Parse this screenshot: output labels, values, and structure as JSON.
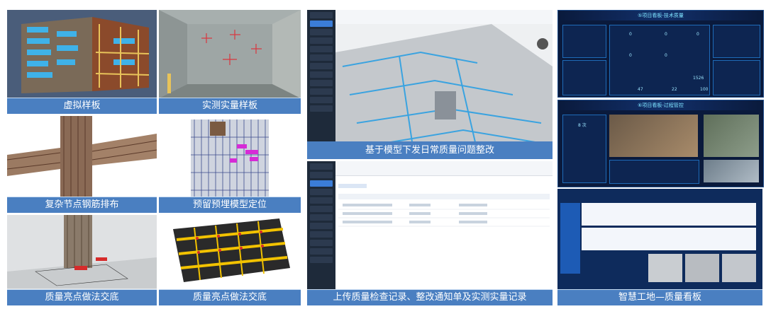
{
  "captions": {
    "virtual_sample": "虚拟样板",
    "measured_sample": "实测实量样板",
    "rebar_layout": "复杂节点钢筋排布",
    "embedded_position": "预留预埋模型定位",
    "quality_demo_1": "质量亮点做法交底",
    "quality_demo_2": "质量亮点做法交底",
    "model_rectify": "基于模型下发日常质量问题整改",
    "upload_records": "上传质量检查记录、整改通知单及实测实量记录",
    "smart_site": "智慧工地—质量看板"
  },
  "dashboards": {
    "tech_quality_title": "⑤项目看板-技术质量",
    "process_title": "⑥项目看板-过程管控",
    "process_stat": "8 次",
    "tech_values": [
      "0",
      "0",
      "0",
      "0",
      "0",
      "1526",
      "47",
      "22",
      "100"
    ]
  },
  "colors": {
    "caption_bg": "#4a7fc1",
    "dash_bg": "#0a1a3c",
    "dash_accent": "#7fe3ff"
  }
}
